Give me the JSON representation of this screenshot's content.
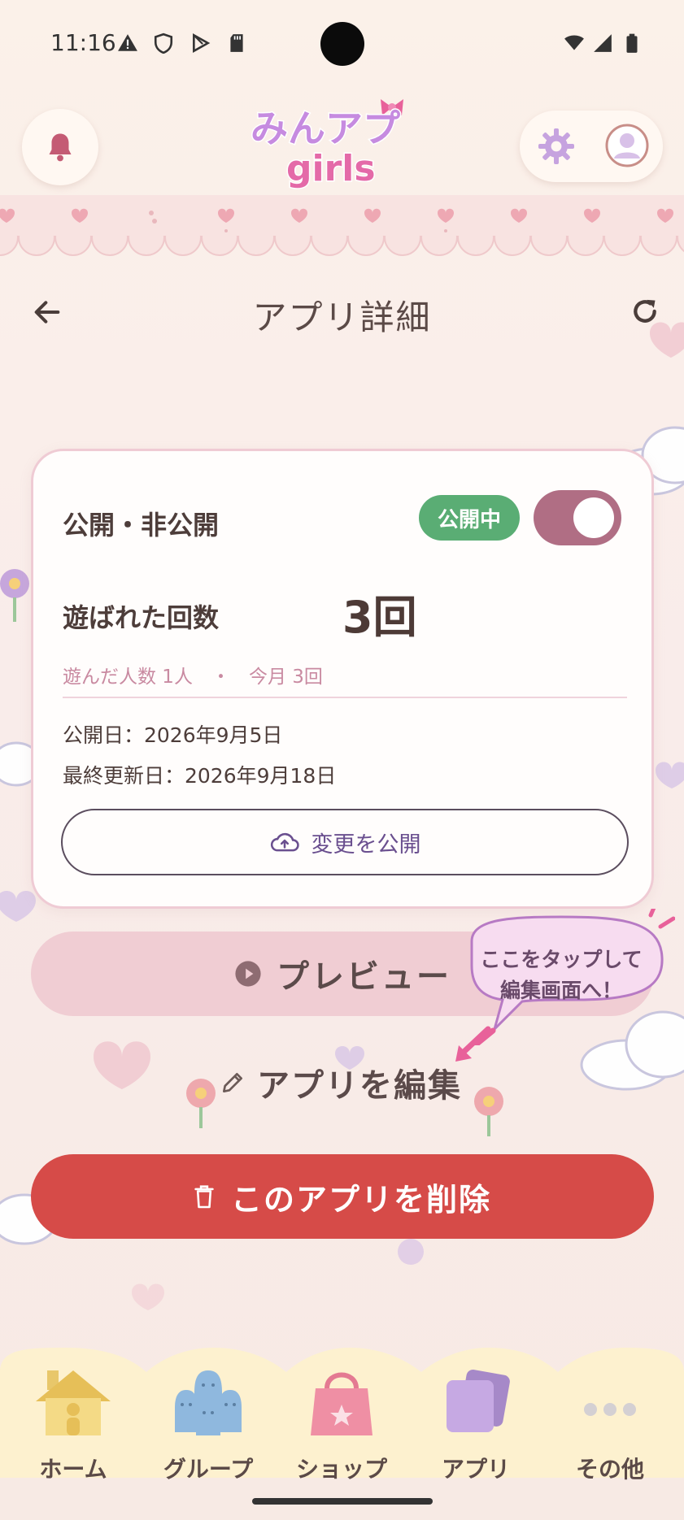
{
  "status_bar": {
    "time": "11:16",
    "icons": [
      "warning-icon",
      "shield-icon",
      "play-store-icon",
      "sd-card-icon",
      "wifi-icon",
      "signal-icon",
      "battery-icon"
    ]
  },
  "header": {
    "logo_text_top": "みんアプ",
    "logo_text_bottom": "girls"
  },
  "page": {
    "title": "アプリ詳細"
  },
  "card": {
    "visibility_label": "公開・非公開",
    "status_badge": "公開中",
    "toggle_on": true,
    "play_count_label": "遊ばれた回数",
    "play_count_value": "3回",
    "stats_sub": "遊んだ人数 1人　・　今月 3回",
    "publish_date": "公開日：2026年9月5日",
    "updated_date": "最終更新日：2026年9月18日",
    "publish_changes_label": "変更を公開"
  },
  "actions": {
    "preview_label": "プレビュー",
    "tooltip_line1": "ここをタップして",
    "tooltip_line2": "編集画面へ！",
    "edit_label": "アプリを編集",
    "delete_label": "このアプリを削除"
  },
  "bottom_nav": {
    "items": [
      {
        "label": "ホーム",
        "icon": "house-icon"
      },
      {
        "label": "グループ",
        "icon": "group-icon"
      },
      {
        "label": "ショップ",
        "icon": "shopping-bag-icon"
      },
      {
        "label": "アプリ",
        "icon": "app-cards-icon"
      },
      {
        "label": "その他",
        "icon": "more-dots-icon"
      }
    ]
  },
  "colors": {
    "background": "#fbf1e9",
    "toggle": "#b06e84",
    "badge_green": "#5aad74",
    "delete_red": "#d64b48",
    "preview_pink": "#f0cdd3",
    "accent_purple": "#6a4f8f"
  }
}
